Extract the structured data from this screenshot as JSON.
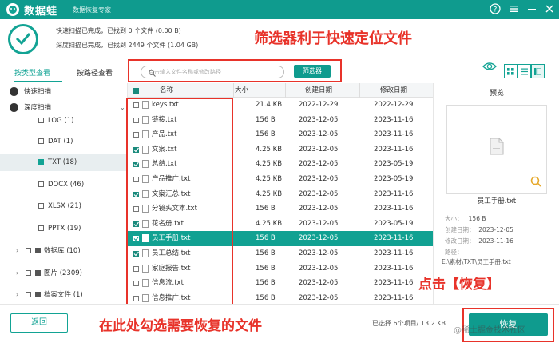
{
  "app": {
    "name": "数据蛙",
    "subtitle": "数据恢复专家"
  },
  "titlebar": {
    "help_icon": "help-icon",
    "menu_icon": "menu-icon",
    "minimize_icon": "minimize-icon",
    "close_icon": "close-icon"
  },
  "scan": {
    "quick": "快速扫描已完成，已找到 0 个文件 (0.00  B)",
    "deep": "深度扫描已完成，已找到 2449 个文件 (1.04 GB)"
  },
  "annotations": {
    "filter": "筛选器利于快速定位文件",
    "check": "在此处勾选需要恢复的文件",
    "recover": "点击【恢复】"
  },
  "tabs": [
    "按类型查看",
    "按路径查看"
  ],
  "toolbar": {
    "search_placeholder": "点击输入文件名称或修改路径",
    "filter_label": "筛选器"
  },
  "sidebar": {
    "items": [
      {
        "label": "快速扫描",
        "kind": "section"
      },
      {
        "label": "深度扫描",
        "kind": "section"
      },
      {
        "label": "LOG (1)"
      },
      {
        "label": "DAT (1)"
      },
      {
        "label": "TXT (18)"
      },
      {
        "label": "DOCX (46)"
      },
      {
        "label": "XLSX (21)"
      },
      {
        "label": "PPTX (19)"
      },
      {
        "label": "数据库 (10)"
      },
      {
        "label": "图片 (2309)"
      },
      {
        "label": "档案文件 (1)"
      }
    ]
  },
  "list": {
    "headers": {
      "name": "名称",
      "size": "大小",
      "created": "创建日期",
      "modified": "修改日期"
    },
    "rows": [
      {
        "name": "keys.txt",
        "size": "21.4 KB",
        "created": "2022-12-29",
        "modified": "2022-12-29",
        "checked": false,
        "selected": false
      },
      {
        "name": "链接.txt",
        "size": "156  B",
        "created": "2023-12-05",
        "modified": "2023-11-16",
        "checked": false,
        "selected": false
      },
      {
        "name": "产品.txt",
        "size": "156  B",
        "created": "2023-12-05",
        "modified": "2023-11-16",
        "checked": false,
        "selected": false
      },
      {
        "name": "文案.txt",
        "size": "4.25 KB",
        "created": "2023-12-05",
        "modified": "2023-11-16",
        "checked": true,
        "selected": false
      },
      {
        "name": "总结.txt",
        "size": "4.25 KB",
        "created": "2023-12-05",
        "modified": "2023-05-19",
        "checked": true,
        "selected": false
      },
      {
        "name": "产品推广.txt",
        "size": "4.25 KB",
        "created": "2023-12-05",
        "modified": "2023-05-19",
        "checked": false,
        "selected": false
      },
      {
        "name": "文案汇总.txt",
        "size": "4.25 KB",
        "created": "2023-12-05",
        "modified": "2023-11-16",
        "checked": true,
        "selected": false
      },
      {
        "name": "分镜头文本.txt",
        "size": "156  B",
        "created": "2023-12-05",
        "modified": "2023-11-16",
        "checked": false,
        "selected": false
      },
      {
        "name": "花名册.txt",
        "size": "4.25 KB",
        "created": "2023-12-05",
        "modified": "2023-05-19",
        "checked": true,
        "selected": false
      },
      {
        "name": "员工手册.txt",
        "size": "156  B",
        "created": "2023-12-05",
        "modified": "2023-11-16",
        "checked": true,
        "selected": true
      },
      {
        "name": "员工总结.txt",
        "size": "156  B",
        "created": "2023-12-05",
        "modified": "2023-11-16",
        "checked": true,
        "selected": false
      },
      {
        "name": "家庭报告.txt",
        "size": "156  B",
        "created": "2023-12-05",
        "modified": "2023-11-16",
        "checked": false,
        "selected": false
      },
      {
        "name": "信息流.txt",
        "size": "156  B",
        "created": "2023-12-05",
        "modified": "2023-11-16",
        "checked": false,
        "selected": false
      },
      {
        "name": "信息推广.txt",
        "size": "156  B",
        "created": "2023-12-05",
        "modified": "2023-11-16",
        "checked": false,
        "selected": false
      }
    ]
  },
  "preview": {
    "title": "预览",
    "filename": "员工手册.txt",
    "size_label": "大小：",
    "size": "156  B",
    "created_label": "创建日期：",
    "created": "2023-12-05",
    "modified_label": "修改日期：",
    "modified": "2023-11-16",
    "path_label": "路径：",
    "path": "E:\\素材\\TXT\\员工手册.txt"
  },
  "footer": {
    "back": "返回",
    "selected_info": "已选择 6个项目/ 13.2 KB",
    "recover": "恢复"
  },
  "watermark": "@稀土掘金技术社区",
  "colors": {
    "accent": "#0f9b8e",
    "annotation": "#e8332a"
  }
}
